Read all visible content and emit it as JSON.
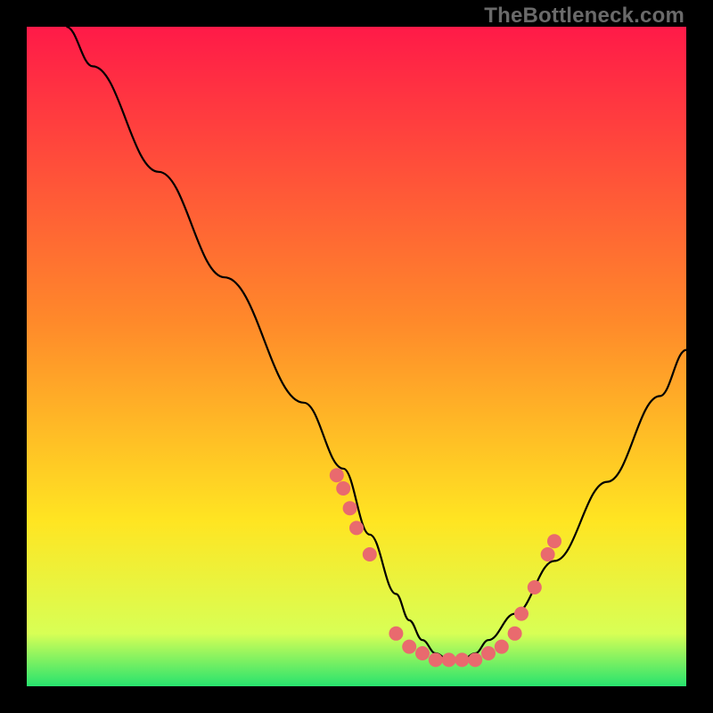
{
  "watermark": "TheBottleneck.com",
  "gradient_stops": [
    "#ff1a48",
    "#ff8a2a",
    "#ffe522",
    "#d8ff55",
    "#27e36e"
  ],
  "chart_data": {
    "type": "line",
    "title": "",
    "xlabel": "",
    "ylabel": "",
    "xlim": [
      0,
      100
    ],
    "ylim": [
      0,
      100
    ],
    "series": [
      {
        "name": "curve",
        "x": [
          6,
          10,
          20,
          30,
          42,
          48,
          52,
          56,
          58,
          60,
          62,
          64,
          66,
          68,
          70,
          74,
          80,
          88,
          96,
          100
        ],
        "y": [
          100,
          94,
          78,
          62,
          43,
          33,
          23,
          14,
          10,
          7,
          5,
          4,
          4,
          5,
          7,
          11,
          19,
          31,
          44,
          51
        ]
      },
      {
        "name": "dot-cluster",
        "x": [
          47,
          48,
          49,
          50,
          52,
          56,
          58,
          60,
          62,
          64,
          66,
          68,
          70,
          72,
          74,
          75,
          77,
          79,
          80
        ],
        "y": [
          32,
          30,
          27,
          24,
          20,
          8,
          6,
          5,
          4,
          4,
          4,
          4,
          5,
          6,
          8,
          11,
          15,
          20,
          22
        ]
      }
    ]
  }
}
